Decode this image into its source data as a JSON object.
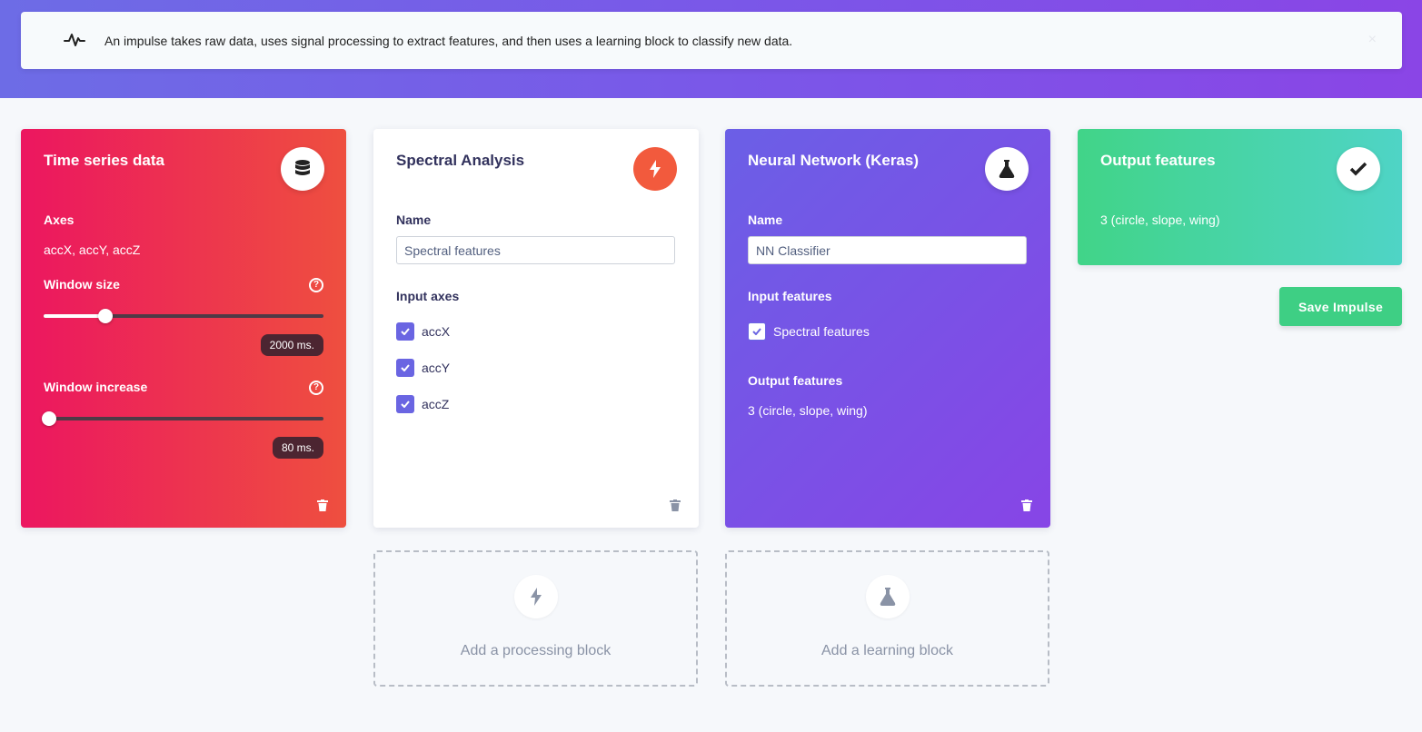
{
  "alert": {
    "text": "An impulse takes raw data, uses signal processing to extract features, and then uses a learning block to classify new data.",
    "close": "×"
  },
  "time_series": {
    "title": "Time series data",
    "axes_label": "Axes",
    "axes_value": "accX, accY, accZ",
    "window_size_label": "Window size",
    "window_size_value": "2000 ms.",
    "window_size_fraction": 0.22,
    "window_increase_label": "Window increase",
    "window_increase_value": "80 ms.",
    "window_increase_fraction": 0.0,
    "help": "?"
  },
  "spectral": {
    "title": "Spectral Analysis",
    "name_label": "Name",
    "name_value": "Spectral features",
    "input_axes_label": "Input axes",
    "axes": [
      "accX",
      "accY",
      "accZ"
    ]
  },
  "neural": {
    "title": "Neural Network (Keras)",
    "name_label": "Name",
    "name_value": "NN Classifier",
    "input_features_label": "Input features",
    "input_feature": "Spectral features",
    "output_features_label": "Output features",
    "output_features_value": "3 (circle, slope, wing)"
  },
  "output": {
    "title": "Output features",
    "value": "3 (circle, slope, wing)"
  },
  "save_button": "Save Impulse",
  "add_processing": "Add a processing block",
  "add_learning": "Add a learning block",
  "colors": {
    "accent": "#6a65e2",
    "time_series_start": "#ec1660",
    "time_series_end": "#ee4f3f",
    "spectral_badge": "#f25a3d",
    "neural_start": "#6b5fe6",
    "neural_end": "#8745e6",
    "output_start": "#41d488",
    "output_end": "#4fd4c6",
    "save": "#3ecf84"
  },
  "icons": {
    "alert": "pulse-icon",
    "time_series": "database-icon",
    "spectral": "bolt-icon",
    "neural": "flask-icon",
    "output": "check-icon",
    "delete": "trash-icon"
  }
}
